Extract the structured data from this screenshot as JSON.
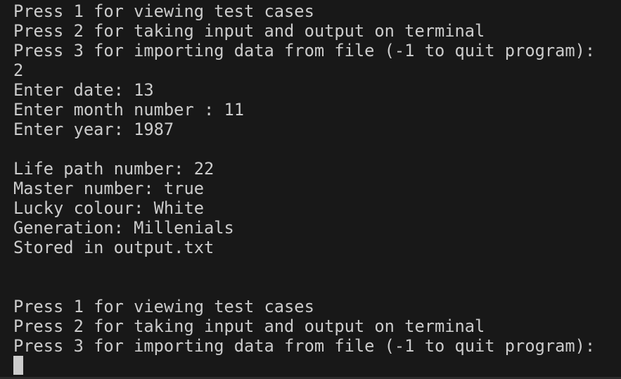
{
  "terminal": {
    "lines": [
      "Press 1 for viewing test cases",
      "Press 2 for taking input and output on terminal",
      "Press 3 for importing data from file (-1 to quit program):",
      "2",
      "Enter date: 13",
      "Enter month number : 11",
      "Enter year: 1987",
      "",
      "Life path number: 22",
      "Master number: true",
      "Lucky colour: White",
      "Generation: Millenials",
      "Stored in output.txt",
      "",
      "",
      "Press 1 for viewing test cases",
      "Press 2 for taking input and output on terminal",
      "Press 3 for importing data from file (-1 to quit program):"
    ]
  }
}
